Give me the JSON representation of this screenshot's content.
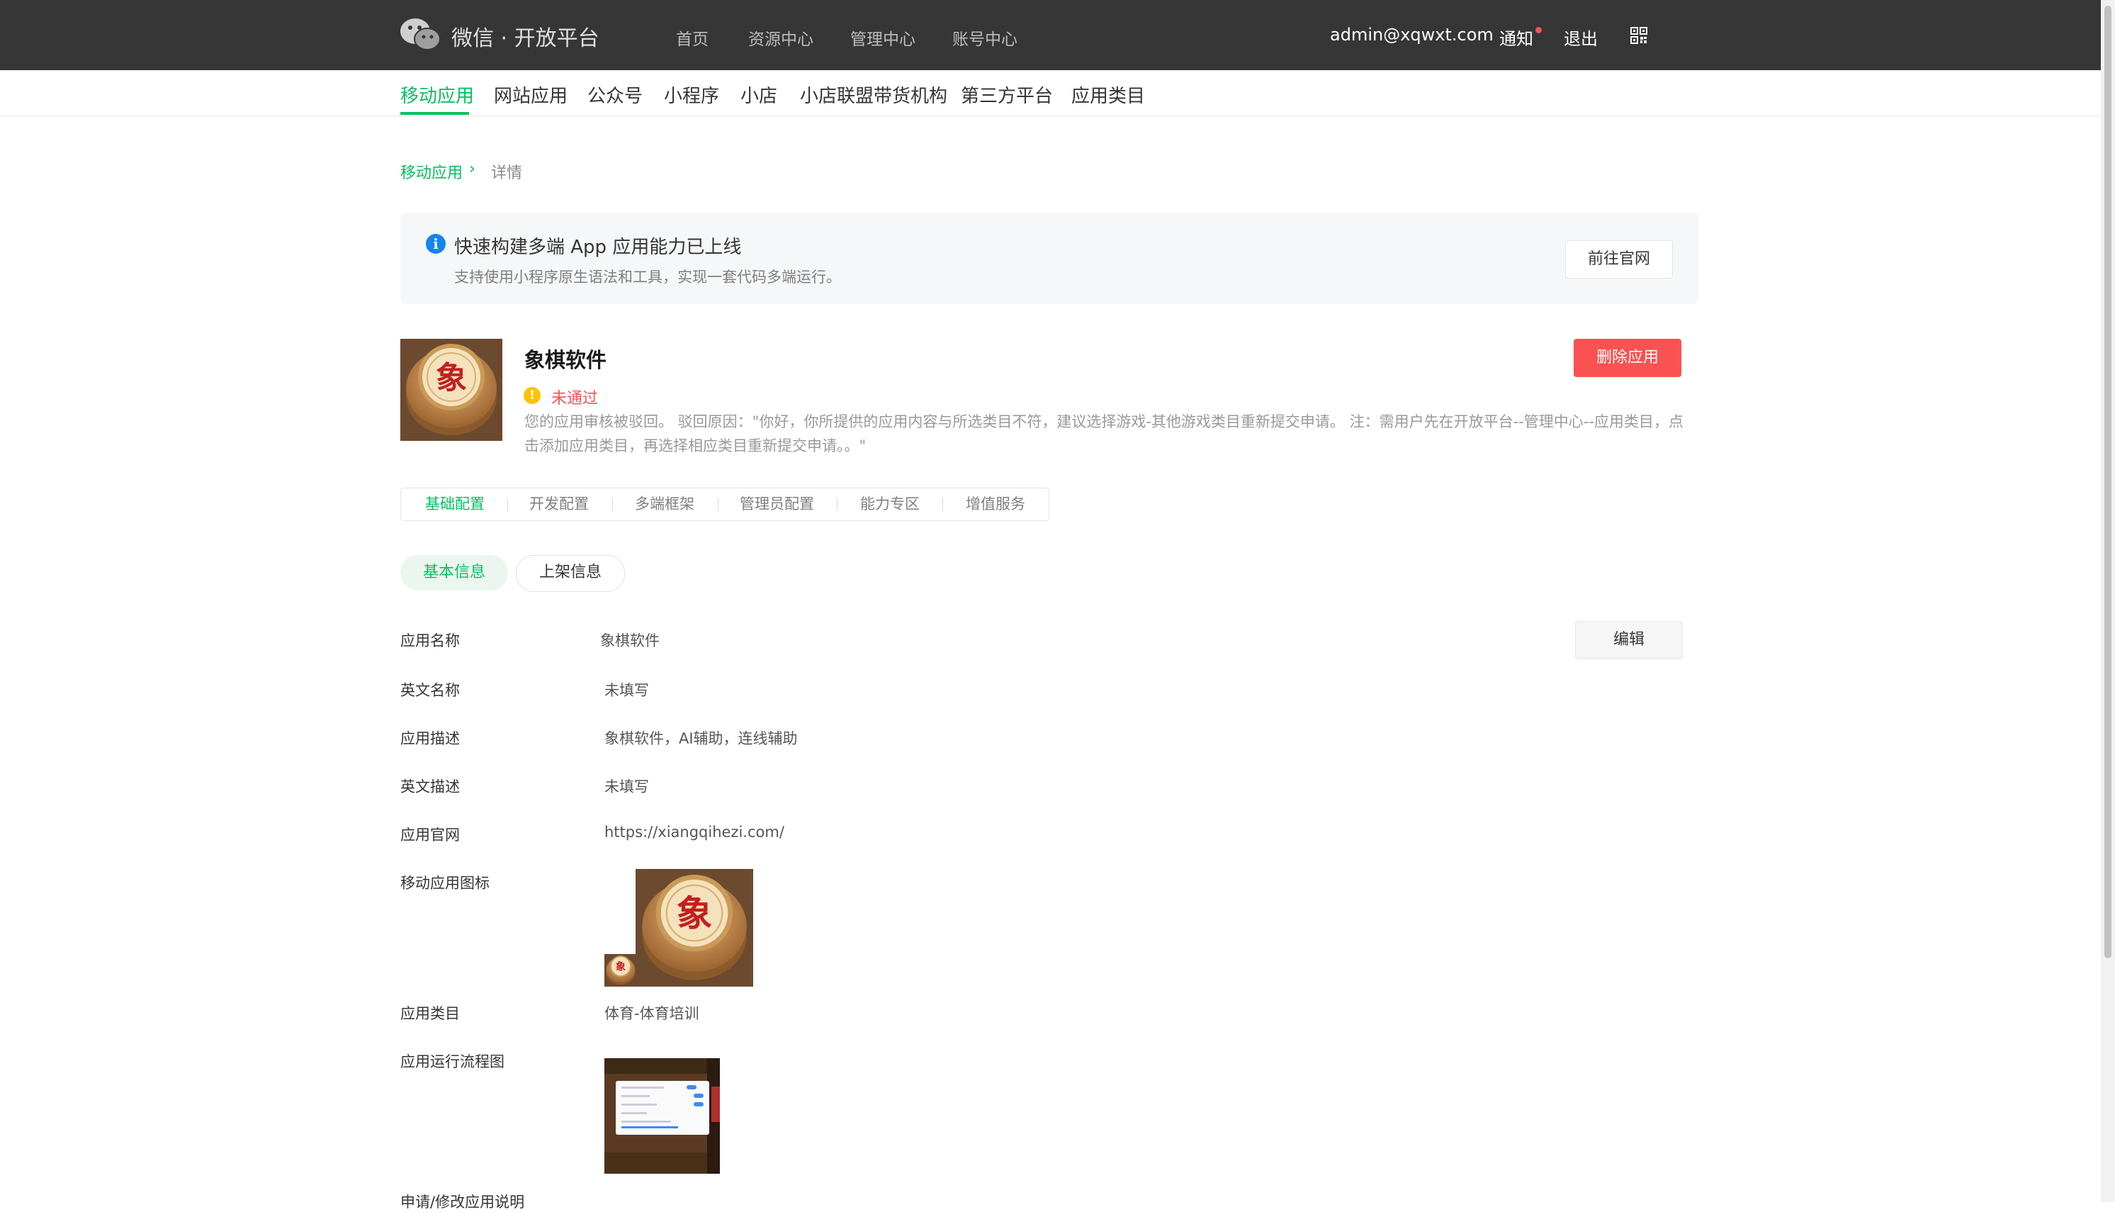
{
  "header": {
    "brand": "微信 · 开放平台",
    "nav": [
      "首页",
      "资源中心",
      "管理中心",
      "账号中心"
    ],
    "account": "admin@xqwxt.com",
    "notify": "通知",
    "logout": "退出"
  },
  "categories": [
    "移动应用",
    "网站应用",
    "公众号",
    "小程序",
    "小店",
    "小店联盟带货机构",
    "第三方平台",
    "应用类目"
  ],
  "breadcrumb": {
    "root": "移动应用",
    "separator": "›",
    "current": "详情"
  },
  "banner": {
    "title": "快速构建多端 App 应用能力已上线",
    "desc": "支持使用小程序原生语法和工具，实现一套代码多端运行。",
    "button": "前往官网"
  },
  "app": {
    "name": "象棋软件",
    "status": "未通过",
    "reason": "您的应用审核被驳回。 驳回原因：\"你好，你所提供的应用内容与所选类目不符，建议选择游戏-其他游戏类目重新提交申请。 注：需用户先在开放平台--管理中心--应用类目，点击添加应用类目，再选择相应类目重新提交申请。。\"",
    "delete_button": "删除应用",
    "icon_char": "象"
  },
  "tabs": [
    "基础配置",
    "开发配置",
    "多端框架",
    "管理员配置",
    "能力专区",
    "增值服务"
  ],
  "pills": [
    "基本信息",
    "上架信息"
  ],
  "fields": {
    "edit_button": "编辑",
    "name_label": "应用名称",
    "name_value": "象棋软件",
    "en_name_label": "英文名称",
    "en_name_value": "未填写",
    "desc_label": "应用描述",
    "desc_value": "象棋软件，AI辅助，连线辅助",
    "en_desc_label": "英文描述",
    "en_desc_value": "未填写",
    "site_label": "应用官网",
    "site_value": "https://xiangqihezi.com/",
    "icon_label": "移动应用图标",
    "category_label": "应用类目",
    "category_value": "体育-体育培训",
    "flow_label": "应用运行流程图",
    "apply_label": "申请/修改应用说明"
  },
  "colors": {
    "accent": "#07c160",
    "danger": "#fa5151",
    "topbar": "#363636",
    "info": "#1485ee",
    "warning": "#ffc300"
  }
}
